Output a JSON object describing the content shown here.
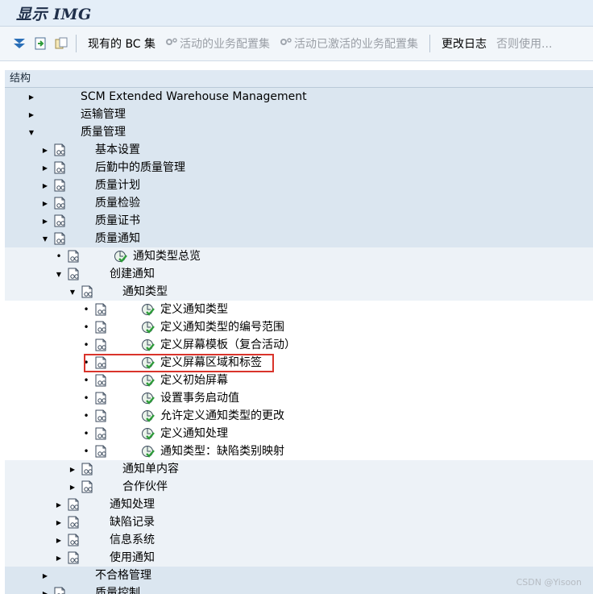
{
  "window": {
    "title": "显示 IMG"
  },
  "toolbar": {
    "icons": [
      "expand-icon",
      "document-arrow-icon",
      "document-copy-icon"
    ],
    "buttons": [
      {
        "label": "现有的 BC 集",
        "enabled": true
      },
      {
        "label": "活动的业务配置集",
        "enabled": false,
        "icon": "gear-icon"
      },
      {
        "label": "活动已激活的业务配置集",
        "enabled": false,
        "icon": "gear-icon"
      },
      {
        "label": "更改日志",
        "enabled": true
      },
      {
        "label": "否则使用...",
        "enabled": false
      }
    ]
  },
  "tree": {
    "header": "结构",
    "rows": [
      {
        "label": "SCM Extended Warehouse Management",
        "level": 0,
        "toggle": "collapsed",
        "folder": false,
        "activity": false
      },
      {
        "label": "运输管理",
        "level": 0,
        "toggle": "collapsed",
        "folder": false,
        "activity": false
      },
      {
        "label": "质量管理",
        "level": 0,
        "toggle": "expanded",
        "folder": false,
        "activity": false
      },
      {
        "label": "基本设置",
        "level": 1,
        "toggle": "collapsed",
        "folder": true,
        "activity": false
      },
      {
        "label": "后勤中的质量管理",
        "level": 1,
        "toggle": "collapsed",
        "folder": true,
        "activity": false
      },
      {
        "label": "质量计划",
        "level": 1,
        "toggle": "collapsed",
        "folder": true,
        "activity": false
      },
      {
        "label": "质量检验",
        "level": 1,
        "toggle": "collapsed",
        "folder": true,
        "activity": false
      },
      {
        "label": "质量证书",
        "level": 1,
        "toggle": "collapsed",
        "folder": true,
        "activity": false
      },
      {
        "label": "质量通知",
        "level": 1,
        "toggle": "expanded",
        "folder": true,
        "activity": false
      },
      {
        "label": "通知类型总览",
        "level": 2,
        "toggle": "leaf",
        "folder": true,
        "activity": true
      },
      {
        "label": "创建通知",
        "level": 2,
        "toggle": "expanded",
        "folder": true,
        "activity": false
      },
      {
        "label": "通知类型",
        "level": 3,
        "toggle": "expanded",
        "folder": true,
        "activity": false
      },
      {
        "label": "定义通知类型",
        "level": 4,
        "toggle": "leaf",
        "folder": true,
        "activity": true
      },
      {
        "label": "定义通知类型的编号范围",
        "level": 4,
        "toggle": "leaf",
        "folder": true,
        "activity": true
      },
      {
        "label": "定义屏幕模板（复合活动）",
        "level": 4,
        "toggle": "leaf",
        "folder": true,
        "activity": true
      },
      {
        "label": "定义屏幕区域和标签",
        "level": 4,
        "toggle": "leaf",
        "folder": true,
        "activity": true,
        "highlighted": true
      },
      {
        "label": "定义初始屏幕",
        "level": 4,
        "toggle": "leaf",
        "folder": true,
        "activity": true
      },
      {
        "label": "设置事务启动值",
        "level": 4,
        "toggle": "leaf",
        "folder": true,
        "activity": true
      },
      {
        "label": "允许定义通知类型的更改",
        "level": 4,
        "toggle": "leaf",
        "folder": true,
        "activity": true
      },
      {
        "label": "定义通知处理",
        "level": 4,
        "toggle": "leaf",
        "folder": true,
        "activity": true
      },
      {
        "label": "通知类型：缺陷类别映射",
        "level": 4,
        "toggle": "leaf",
        "folder": true,
        "activity": true
      },
      {
        "label": "通知单内容",
        "level": 3,
        "toggle": "collapsed",
        "folder": true,
        "activity": false
      },
      {
        "label": "合作伙伴",
        "level": 3,
        "toggle": "collapsed",
        "folder": true,
        "activity": false
      },
      {
        "label": "通知处理",
        "level": 2,
        "toggle": "collapsed",
        "folder": true,
        "activity": false
      },
      {
        "label": "缺陷记录",
        "level": 2,
        "toggle": "collapsed",
        "folder": true,
        "activity": false
      },
      {
        "label": "信息系统",
        "level": 2,
        "toggle": "collapsed",
        "folder": true,
        "activity": false
      },
      {
        "label": "使用通知",
        "level": 2,
        "toggle": "collapsed",
        "folder": true,
        "activity": false
      },
      {
        "label": "不合格管理",
        "level": 1,
        "toggle": "collapsed",
        "folder": false,
        "activity": false
      },
      {
        "label": "质量控制",
        "level": 1,
        "toggle": "collapsed",
        "folder": true,
        "activity": false
      }
    ]
  },
  "watermark": "CSDN @Yisoon"
}
